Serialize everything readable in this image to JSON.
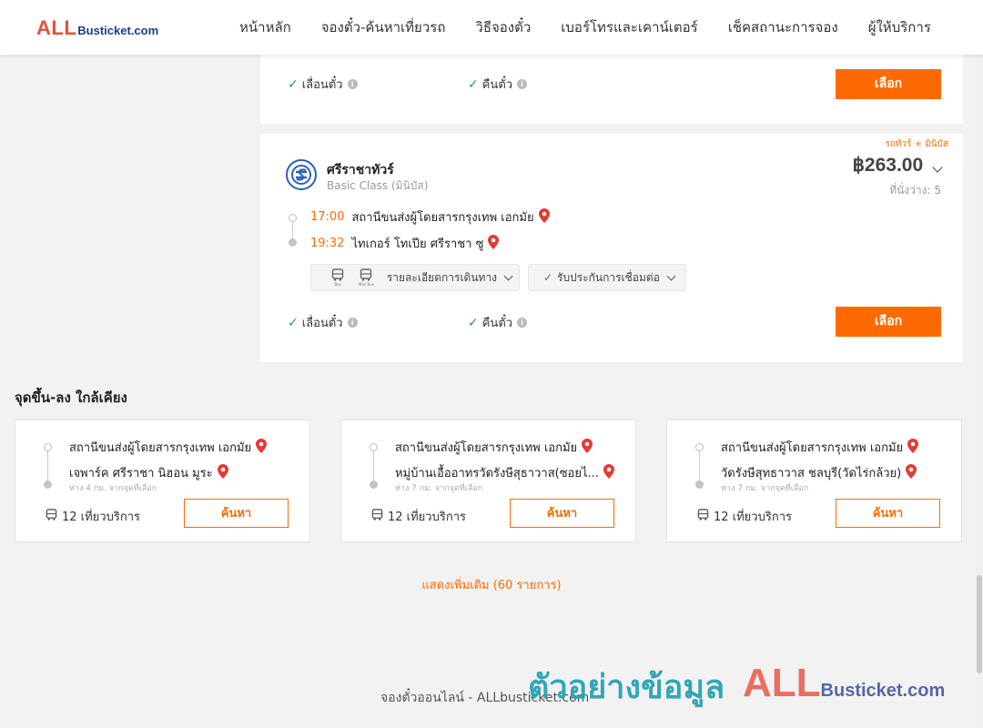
{
  "header": {
    "logo_all": "ALL",
    "logo_bus": "Busticket.com",
    "nav": [
      "หน้าหลัก",
      "จองตั๋ว-ค้นหาเที่ยวรถ",
      "วิธีจองตั๋ว",
      "เบอร์โทรและเคาน์เตอร์",
      "เช็คสถานะการจอง",
      "ผู้ให้บริการ"
    ]
  },
  "card1": {
    "feature_change": "เลื่อนตั๋ว",
    "feature_refund": "คืนตั๋ว",
    "select_label": "เลือก"
  },
  "card2": {
    "tag": "รถทัวร์ + มินิบัส",
    "operator": "ศรีราชาทัวร์",
    "class": "Basic Class (มินิบัส)",
    "price": "฿263.00",
    "seats": "ที่นั่งว่าง: 5",
    "depart_time": "17:00",
    "depart_stop": "สถานีขนส่งผู้โดยสารกรุงเทพ เอกมัย",
    "arrive_time": "19:32",
    "arrive_stop": "ไทเกอร์ โทเปีย ศรีราชา ซู",
    "bus_icon_label": "Bus",
    "minibus_icon_label": "Mini Bus",
    "route_details": "รายละเอียดการเดินทาง",
    "connection_guarantee": "รับประกันการเชื่อมต่อ",
    "feature_change": "เลื่อนตั๋ว",
    "feature_refund": "คืนตั๋ว",
    "select_label": "เลือก"
  },
  "nearby": {
    "title": "จุดขึ้น-ลง ใกล้เคียง",
    "cards": [
      {
        "from": "สถานีขนส่งผู้โดยสารกรุงเทพ เอกมัย",
        "to": "เจพาร์ค ศรีราชา นิฮอน มูระ",
        "distance": "ห่าง 4 กม. จากจุดที่เลือก",
        "count": "12 เที่ยวบริการ",
        "button": "ค้นหา"
      },
      {
        "from": "สถานีขนส่งผู้โดยสารกรุงเทพ เอกมัย",
        "to": "หมู่บ้านเอื้ออาทรวัดรังษีสุธาวาส(ซอยไ...",
        "distance": "ห่าง 7 กม. จากจุดที่เลือก",
        "count": "12 เที่ยวบริการ",
        "button": "ค้นหา"
      },
      {
        "from": "สถานีขนส่งผู้โดยสารกรุงเทพ เอกมัย",
        "to": "วัดรังษีสุทธาวาส ชลบุรี(วัดไร่กล้วย)",
        "distance": "ห่าง 7 กม. จากจุดที่เลือก",
        "count": "12 เที่ยวบริการ",
        "button": "ค้นหา"
      }
    ],
    "show_more": "แสดงเพิ่มเติม (60 รายการ)"
  },
  "footer": {
    "text": "จองตั๋วออนไลน์ - ALLbusticket.com"
  },
  "watermark": {
    "text": "ตัวอย่างข้อมูล",
    "brand_all": "ALL",
    "brand_bus": "Busticket.com"
  },
  "colors": {
    "accent": "#ff6a00",
    "check": "#2e9b44",
    "pin": "#e53935",
    "logo_red": "#e8503a",
    "logo_blue": "#1f3a93"
  }
}
